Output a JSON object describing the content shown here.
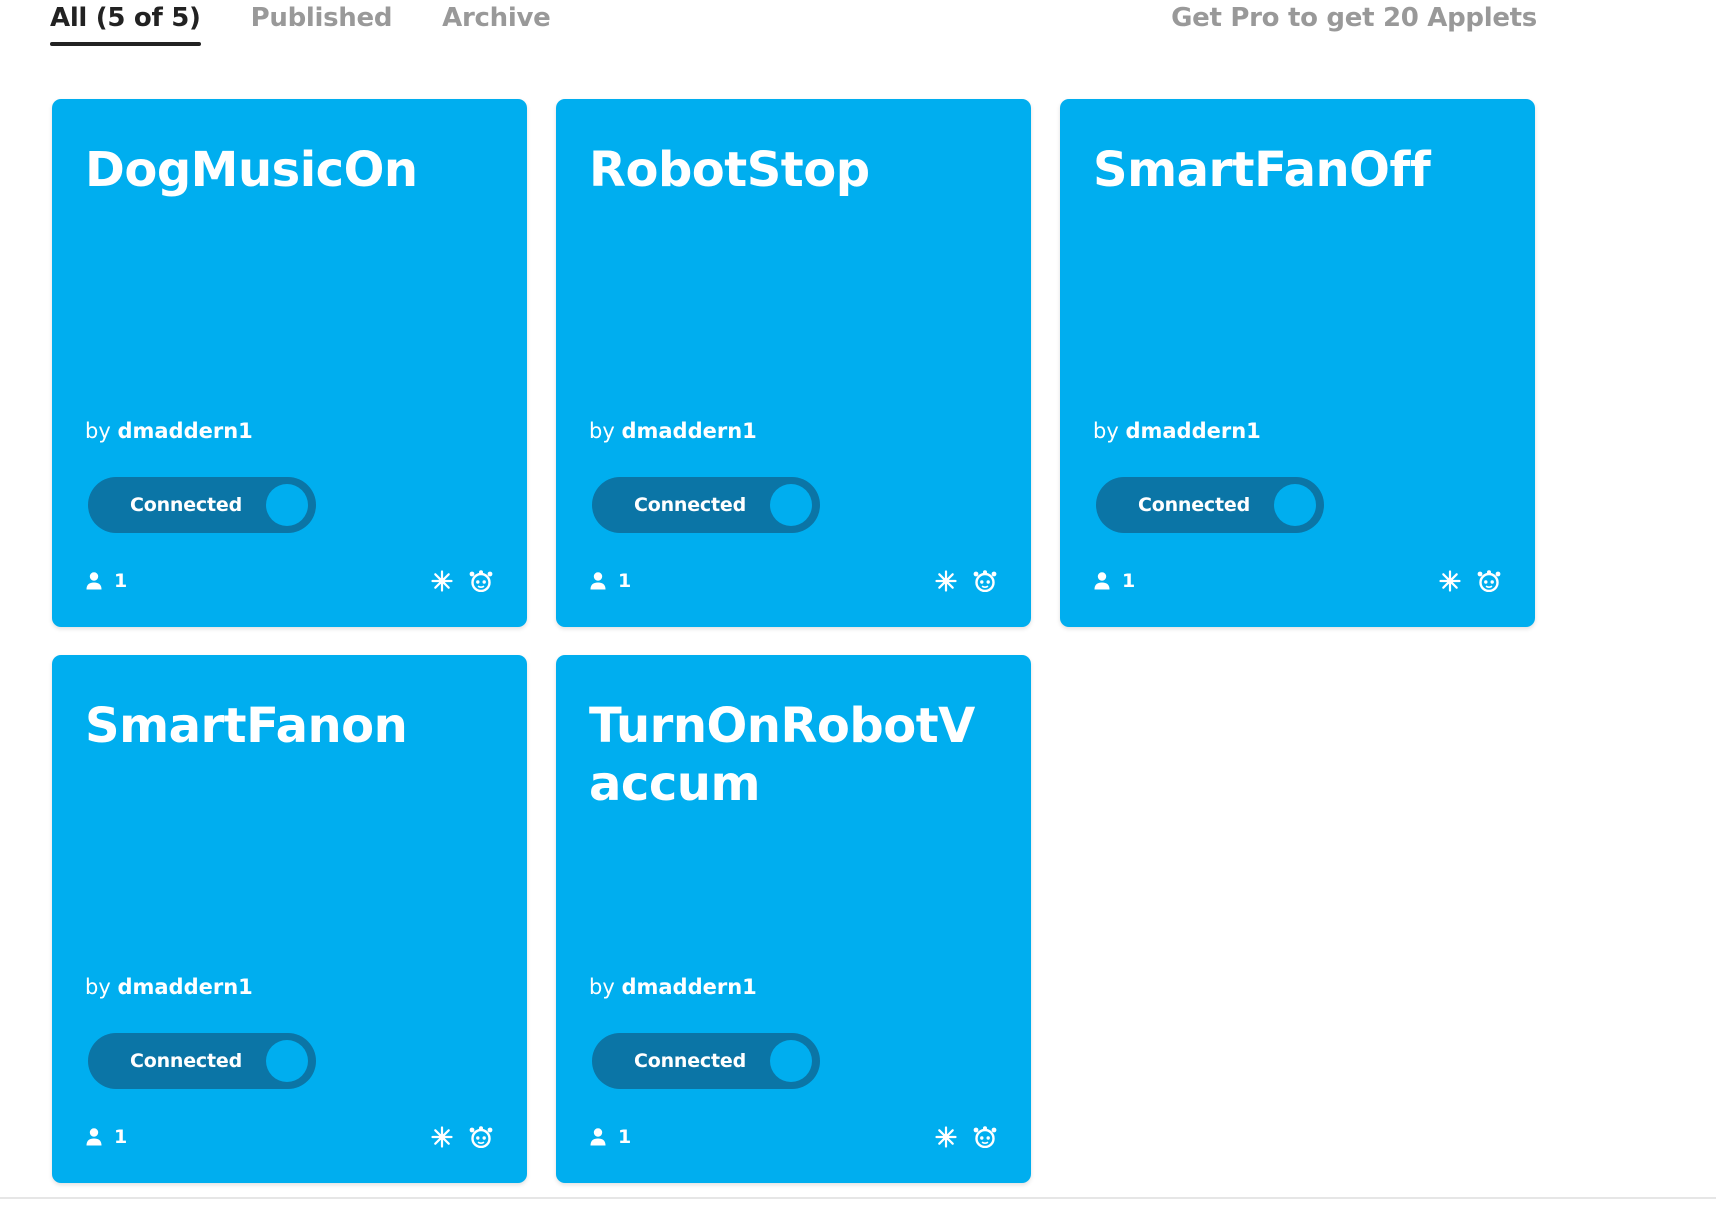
{
  "tabs": [
    {
      "label": "All (5 of 5)",
      "active": true
    },
    {
      "label": "Published",
      "active": false
    },
    {
      "label": "Archive",
      "active": false
    }
  ],
  "pro_link": "Get Pro to get 20 Applets",
  "colors": {
    "card": "#00aeef",
    "toggle": "#0b75a6"
  },
  "applets": [
    {
      "title": "DogMusicOn",
      "by": "by",
      "author": "dmaddern1",
      "status": "Connected",
      "users": "1",
      "service_icons": [
        "spark-icon",
        "robot-icon"
      ]
    },
    {
      "title": "RobotStop",
      "by": "by",
      "author": "dmaddern1",
      "status": "Connected",
      "users": "1",
      "service_icons": [
        "spark-icon",
        "robot-icon"
      ]
    },
    {
      "title": "SmartFanOff",
      "by": "by",
      "author": "dmaddern1",
      "status": "Connected",
      "users": "1",
      "service_icons": [
        "spark-icon",
        "robot-icon"
      ]
    },
    {
      "title": "SmartFanon",
      "by": "by",
      "author": "dmaddern1",
      "status": "Connected",
      "users": "1",
      "service_icons": [
        "spark-icon",
        "robot-icon"
      ]
    },
    {
      "title": "TurnOnRobotVaccum",
      "by": "by",
      "author": "dmaddern1",
      "status": "Connected",
      "users": "1",
      "service_icons": [
        "spark-icon",
        "robot-icon"
      ]
    }
  ]
}
